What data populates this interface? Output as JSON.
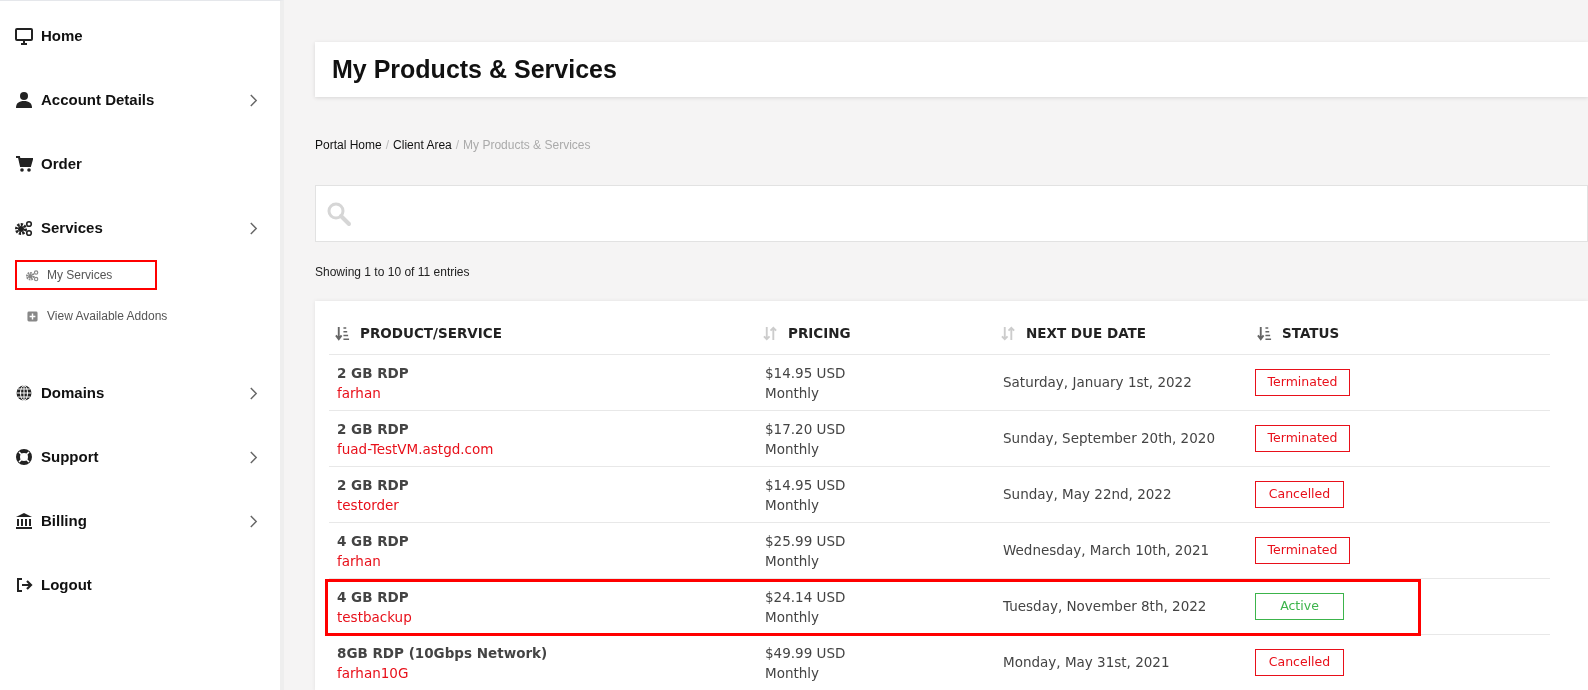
{
  "sidebar": {
    "items": [
      {
        "label": "Home",
        "has_submenu": false
      },
      {
        "label": "Account Details",
        "has_submenu": true
      },
      {
        "label": "Order",
        "has_submenu": false
      },
      {
        "label": "Services",
        "has_submenu": true,
        "children": [
          {
            "label": "My Services",
            "highlighted": true
          },
          {
            "label": "View Available Addons",
            "highlighted": false
          }
        ]
      },
      {
        "label": "Domains",
        "has_submenu": true
      },
      {
        "label": "Support",
        "has_submenu": true
      },
      {
        "label": "Billing",
        "has_submenu": true
      },
      {
        "label": "Logout",
        "has_submenu": false
      }
    ]
  },
  "page_title": "My Products & Services",
  "breadcrumb": [
    {
      "kind": "link",
      "label": "Portal Home"
    },
    {
      "kind": "separator",
      "label": "/"
    },
    {
      "kind": "link",
      "label": "Client Area"
    },
    {
      "kind": "separator",
      "label": "/"
    },
    {
      "kind": "current",
      "label": "My Products & Services"
    }
  ],
  "entries_info": "Showing 1 to 10 of 11 entries",
  "table": {
    "columns": [
      {
        "label": "PRODUCT/SERVICE",
        "sorted": true
      },
      {
        "label": "PRICING",
        "sorted": false
      },
      {
        "label": "NEXT DUE DATE",
        "sorted": false
      },
      {
        "label": "STATUS",
        "sorted": true
      }
    ],
    "rows": [
      {
        "product": "2 GB RDP",
        "domain": "farhan",
        "price": "$14.95 USD",
        "cycle": "Monthly",
        "due": "Saturday, January 1st, 2022",
        "status": "Terminated",
        "kind": "terminated",
        "highlighted": false
      },
      {
        "product": "2 GB RDP",
        "domain": "fuad-TestVM.astgd.com",
        "price": "$17.20 USD",
        "cycle": "Monthly",
        "due": "Sunday, September 20th, 2020",
        "status": "Terminated",
        "kind": "terminated",
        "highlighted": false
      },
      {
        "product": "2 GB RDP",
        "domain": "testorder",
        "price": "$14.95 USD",
        "cycle": "Monthly",
        "due": "Sunday, May 22nd, 2022",
        "status": "Cancelled",
        "kind": "cancelled",
        "highlighted": false
      },
      {
        "product": "4 GB RDP",
        "domain": "farhan",
        "price": "$25.99 USD",
        "cycle": "Monthly",
        "due": "Wednesday, March 10th, 2021",
        "status": "Terminated",
        "kind": "terminated",
        "highlighted": false
      },
      {
        "product": "4 GB RDP",
        "domain": "testbackup",
        "price": "$24.14 USD",
        "cycle": "Monthly",
        "due": "Tuesday, November 8th, 2022",
        "status": "Active",
        "kind": "active",
        "highlighted": true
      },
      {
        "product": "8GB RDP (10Gbps Network)",
        "domain": "farhan10G",
        "price": "$49.99 USD",
        "cycle": "Monthly",
        "due": "Monday, May 31st, 2021",
        "status": "Cancelled",
        "kind": "cancelled",
        "highlighted": false
      }
    ]
  }
}
